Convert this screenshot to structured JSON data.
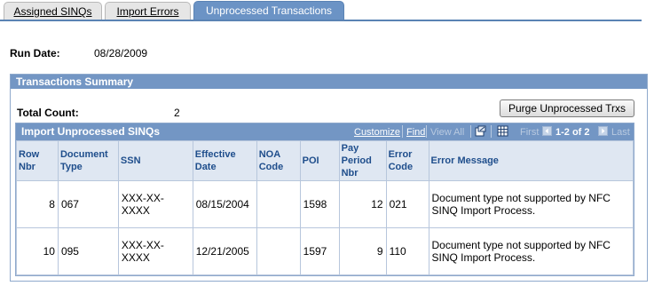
{
  "tabs": [
    {
      "label": "Assigned SINQs"
    },
    {
      "label": "Import Errors"
    },
    {
      "label": "Unprocessed Transactions"
    }
  ],
  "run_date": {
    "label": "Run Date:",
    "value": "08/28/2009"
  },
  "summary": {
    "title": "Transactions Summary",
    "total_count_label": "Total Count:",
    "total_count_value": "2",
    "purge_button": "Purge Unprocessed Trxs"
  },
  "grid": {
    "title": "Import Unprocessed SINQs",
    "customize": "Customize",
    "find": "Find",
    "view_all": "View All",
    "first": "First",
    "range": "1-2 of 2",
    "last": "Last",
    "columns": [
      "Row Nbr",
      "Document Type",
      "SSN",
      "Effective Date",
      "NOA Code",
      "POI",
      "Pay Period Nbr",
      "Error Code",
      "Error Message"
    ],
    "rows": [
      {
        "row_nbr": "8",
        "doc_type": "067",
        "ssn": "XXX-XX-XXXX",
        "eff_date": "08/15/2004",
        "noa": "",
        "poi": "1598",
        "pay_period": "12",
        "error_code": "021",
        "error_message": "Document type not supported by NFC SINQ Import Process."
      },
      {
        "row_nbr": "10",
        "doc_type": "095",
        "ssn": "XXX-XX-XXXX",
        "eff_date": "12/21/2005",
        "noa": "",
        "poi": "1597",
        "pay_period": "9",
        "error_code": "110",
        "error_message": "Document type not supported by NFC SINQ Import Process."
      }
    ]
  }
}
